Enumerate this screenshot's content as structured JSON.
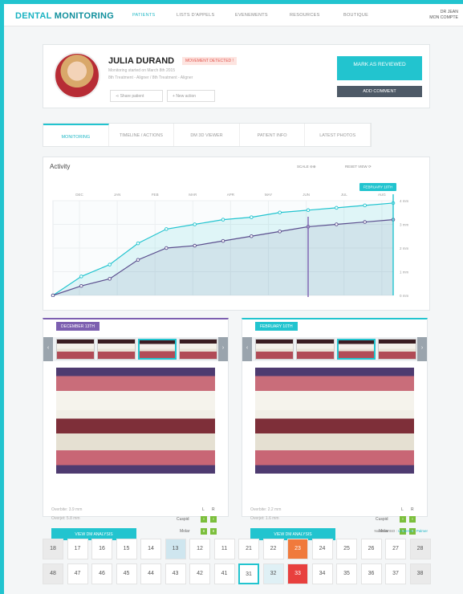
{
  "app": {
    "logo_a": "DENTAL",
    "logo_b": "MONITORING"
  },
  "nav": [
    "PATIENTS",
    "LISTS D'APPELS",
    "EVENEMENTS",
    "RESOURCES",
    "BOUTIQUE"
  ],
  "user": {
    "line1": "DR JEAN",
    "line2": "MON COMPTE"
  },
  "patient": {
    "name": "JULIA DURAND",
    "badge": "MOVEMENT DETECTED !",
    "line1": "Monitoring started on March 8th 2015",
    "line2": "8th Treatment - Aligner / 8th Treatment - Aligner",
    "share": "Share patient",
    "new_action": "New action",
    "mark_reviewed": "MARK AS REVIEWED",
    "add_comment": "ADD COMMENT"
  },
  "tabs": [
    "MONITORING",
    "TIMELINE / ACTIONS",
    "DM 3D VIEWER",
    "PATIENT INFO",
    "LATEST PHOTOS"
  ],
  "chart_data": {
    "type": "line",
    "title": "Activity",
    "controls": {
      "scale": "SCALE",
      "reset": "RESET VIEW"
    },
    "x": [
      "DEC",
      "JAN",
      "FEB",
      "MAR",
      "APR",
      "MAY",
      "JUN",
      "JUL",
      "AUG"
    ],
    "ylabels": [
      "0 mm",
      "1 mm",
      "2 mm",
      "3 mm",
      "4 mm"
    ],
    "ylim": [
      0,
      4
    ],
    "series": [
      {
        "name": "",
        "color": "#22c4cf",
        "values": [
          0,
          0.8,
          1.3,
          2.2,
          2.8,
          3.0,
          3.2,
          3.3,
          3.5,
          3.6,
          3.7,
          3.8,
          3.9
        ]
      },
      {
        "name": "",
        "color": "#5b4e8e",
        "values": [
          0,
          0.4,
          0.7,
          1.5,
          2.0,
          2.1,
          2.3,
          2.5,
          2.7,
          2.9,
          3.0,
          3.1,
          3.2
        ]
      }
    ],
    "markers": [
      {
        "label": "FEBRUARY 10TH",
        "color": "#22c4cf",
        "index": 12
      },
      {
        "label": "DECEMBER 13TH",
        "color": "#7c5fb0",
        "index": 9
      }
    ]
  },
  "left_panel": {
    "tag": "DECEMBER 13TH",
    "overbite_label": "Overbite:",
    "overbite_value": "3.9 mm",
    "overjet_label": "Overjet:",
    "overjet_value": "5.8 mm",
    "cuspid": "Cuspid",
    "molar": "Molar",
    "L": "L",
    "R": "R",
    "g1": "I",
    "g2": "I",
    "g3": "II",
    "g4": "II",
    "button": "VIEW DM ANALYSIS"
  },
  "right_panel": {
    "tag": "FEBRUARY 10TH",
    "overbite_label": "Overbite:",
    "overbite_value": "2.2 mm",
    "overjet_label": "Overjet:",
    "overjet_value": "1.6 mm",
    "cuspid": "Cuspid",
    "molar": "Molar",
    "L": "L",
    "R": "R",
    "g1": "I",
    "g2": "I",
    "g3": "II",
    "g4": "II",
    "button": "VIEW DM ANALYSIS"
  },
  "notation": {
    "label": "Notation ISO :",
    "options": "Universal - Palmer"
  },
  "teeth": {
    "upper": [
      "18",
      "17",
      "16",
      "15",
      "14",
      "13",
      "12",
      "11",
      "21",
      "22",
      "23",
      "24",
      "25",
      "26",
      "27",
      "28"
    ],
    "lower": [
      "48",
      "47",
      "46",
      "45",
      "44",
      "43",
      "42",
      "41",
      "31",
      "32",
      "33",
      "34",
      "35",
      "36",
      "37",
      "38"
    ]
  }
}
